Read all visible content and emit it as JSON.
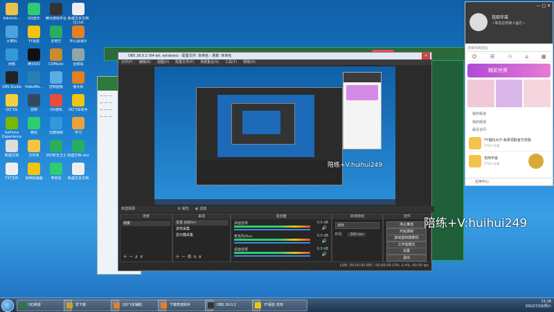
{
  "desktop": {
    "icons": [
      {
        "label": "Adminis...",
        "color": "#e8c24a"
      },
      {
        "label": "QQ音乐",
        "color": "#2ecc71"
      },
      {
        "label": "腾讯游戏平台",
        "color": "#333"
      },
      {
        "label": "新建文本文档 (1).txt",
        "color": "#eee"
      },
      {
        "label": "计算机",
        "color": "#4aa3df"
      },
      {
        "label": "YY语音",
        "color": "#f1c40f"
      },
      {
        "label": "爱奇艺",
        "color": "#27ae60"
      },
      {
        "label": "开心消消乐",
        "color": "#e67e22"
      },
      {
        "label": "网络",
        "color": "#3498db"
      },
      {
        "label": "腾讯QQ",
        "color": "#111"
      },
      {
        "label": "CQMusic",
        "color": "#c98b2b"
      },
      {
        "label": "回收站",
        "color": "#95a5a6"
      },
      {
        "label": "OBS Studio",
        "color": "#222"
      },
      {
        "label": "VideoMe...",
        "color": "#2980b9"
      },
      {
        "label": "控制面板",
        "color": "#5dade2"
      },
      {
        "label": "鲁大师",
        "color": "#e67e22"
      },
      {
        "label": "QQ飞车",
        "color": "#f4d03f"
      },
      {
        "label": "剪映",
        "color": "#34495e"
      },
      {
        "label": "QQ游戏",
        "color": "#e74c3c"
      },
      {
        "label": "QQ飞车助手",
        "color": "#f1c40f"
      },
      {
        "label": "GeForce Experience",
        "color": "#76b900"
      },
      {
        "label": "微信",
        "color": "#2ecc71"
      },
      {
        "label": "优酷视频",
        "color": "#3498db"
      },
      {
        "label": "学习",
        "color": "#e8a33d"
      },
      {
        "label": "新建文档",
        "color": "#ddd"
      },
      {
        "label": "文件夹",
        "color": "#f5c542"
      },
      {
        "label": "360安全卫士",
        "color": "#27ae60"
      },
      {
        "label": "新建文档.xlsx",
        "color": "#27ae60"
      },
      {
        "label": "TXT文件",
        "color": "#eee"
      },
      {
        "label": "雷神加速器",
        "color": "#f1c40f"
      },
      {
        "label": "奇安信",
        "color": "#2ecc71"
      },
      {
        "label": "新建文本文档",
        "color": "#eee"
      }
    ]
  },
  "obs": {
    "title": "OBS 26.0.2 (64-bit, windows) - 配置文件: 未命名 - 场景: 未命名",
    "menu": [
      "文件(F)",
      "编辑(E)",
      "视图(V)",
      "配置文件(P)",
      "场景集合(S)",
      "工具(T)",
      "帮助(H)"
    ],
    "preview_label": "未选择源",
    "properties_btn": "属性",
    "filters_btn": "滤镜",
    "docks": {
      "scenes": {
        "title": "场景",
        "items": [
          "场景"
        ]
      },
      "sources": {
        "title": "来源",
        "items": [
          "文本 (GDI+)",
          "游戏采集",
          "显示器采集"
        ]
      },
      "mixer": {
        "title": "混音器",
        "tracks": [
          {
            "name": "桌面音频",
            "db": "0.0 dB"
          },
          {
            "name": "麦克风/Aux",
            "db": "0.0 dB"
          },
          {
            "name": "桌面音频",
            "db": "0.0 dB"
          }
        ]
      },
      "transitions": {
        "title": "转场特效",
        "type": "淡出",
        "duration_label": "时长",
        "duration": "300 ms"
      },
      "controls": {
        "title": "控件",
        "buttons": [
          "停止推流",
          "开始录制",
          "启动虚拟摄像机",
          "工作室模式",
          "设置",
          "退出"
        ]
      }
    },
    "status": "LIVE: 00:00:00   REC: 00:00:00   CPU: 2.4%, 60.00 fps"
  },
  "watermarks": {
    "overlay": "陪练+V:huihui249",
    "preview": "陪练+V:huihui249"
  },
  "qq_panel": {
    "name": "花田半亩",
    "signature": "~事态总然被人面孔~",
    "search": "搜索网络图标",
    "banner": "精彩世界",
    "section_recent": "我的频道",
    "section_list": "我的频道",
    "section_recent2": "最近访问",
    "item1": "YY福利大厅-免费领取官方奖励",
    "item1_sub": "3755人在看",
    "item2": "花田半亩",
    "item2_sub": "3755人在看",
    "footer": "应用中心"
  },
  "taskbar": {
    "items": [
      "QQ频道",
      "爱下载",
      "QQ飞车辅助",
      "下载奇迹助手",
      "OBS 26.0.2",
      "YY语音 花田"
    ],
    "time": "21:16",
    "date": "2022/7/16/周六"
  }
}
